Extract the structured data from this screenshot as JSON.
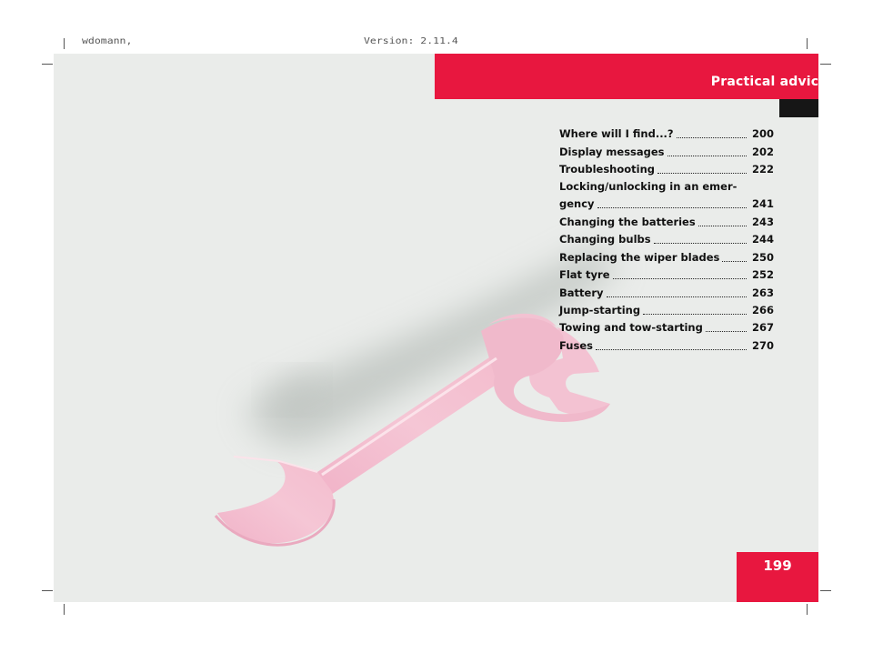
{
  "header": {
    "title": "Practical advice"
  },
  "print_marks": {
    "left_text": "wdomann,",
    "right_text": "Version: 2.11.4"
  },
  "toc": [
    {
      "label": "Where will I find...?",
      "page": "200"
    },
    {
      "label": "Display messages",
      "page": "202"
    },
    {
      "label": "Troubleshooting",
      "page": "222"
    },
    {
      "label": "Locking/unlocking in an emer-",
      "label_cont": "gency",
      "page": "241"
    },
    {
      "label": "Changing the batteries",
      "page": "243"
    },
    {
      "label": "Changing bulbs",
      "page": "244"
    },
    {
      "label": "Replacing the wiper blades",
      "page": "250"
    },
    {
      "label": "Flat tyre",
      "page": "252"
    },
    {
      "label": "Battery",
      "page": "263"
    },
    {
      "label": "Jump-starting",
      "page": "266"
    },
    {
      "label": "Towing and tow-starting",
      "page": "267"
    },
    {
      "label": "Fuses",
      "page": "270"
    }
  ],
  "footer": {
    "page_number": "199"
  },
  "colors": {
    "accent": "#e8173f",
    "page_bg": "#eaecea",
    "wrench": "#f2bfd0"
  },
  "icons": {
    "illustration": "wrench-icon"
  }
}
